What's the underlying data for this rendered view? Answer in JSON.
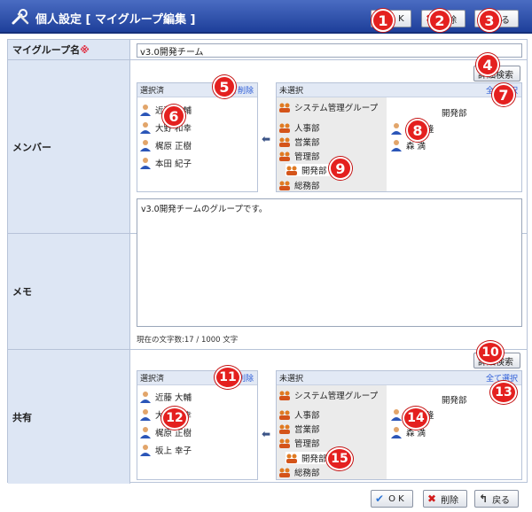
{
  "header": {
    "title": "個人設定 [ マイグループ編集 ]",
    "ok_label": "O K",
    "delete_label": "削除",
    "back_label": "戻る"
  },
  "form": {
    "group_name": {
      "label": "マイグループ名",
      "required_mark": "※",
      "value": "v3.0開発チーム"
    },
    "members": {
      "label": "メンバー",
      "detail_search_label": "詳細検索",
      "selected": {
        "header": "選択済",
        "delete_all": "全て削除",
        "people": [
          "近藤 大輔",
          "大野 和幸",
          "梶原 正樹",
          "本田 紀子"
        ]
      },
      "unselected": {
        "header": "未選択",
        "select_all": "全て選択",
        "groups": [
          "システム管理グループ",
          "人事部",
          "営業部",
          "管理部"
        ],
        "sub_group": "開発部",
        "last_group": "総務部",
        "right_heading": "開発部",
        "people": [
          "高橋 隆",
          "森 満"
        ]
      }
    },
    "memo": {
      "label": "メモ",
      "value": "v3.0開発チームのグループです。",
      "counter": "現在の文字数:17 / 1000 文字"
    },
    "share": {
      "label": "共有",
      "detail_search_label": "詳細検索",
      "selected": {
        "header": "選択済",
        "delete_all": "全て削除",
        "people": [
          "近藤 大輔",
          "大野 和幸",
          "梶原 正樹",
          "坂上 幸子"
        ]
      },
      "unselected": {
        "header": "未選択",
        "select_all": "全て選択",
        "groups": [
          "システム管理グループ",
          "人事部",
          "営業部",
          "管理部"
        ],
        "sub_group": "開発部",
        "last_group": "総務部",
        "right_heading": "開発部",
        "people": [
          "高橋 隆",
          "森 満"
        ]
      }
    }
  },
  "footer": {
    "ok_label": "O K",
    "delete_label": "削除",
    "back_label": "戻る"
  },
  "callouts": [
    "1",
    "2",
    "3",
    "4",
    "5",
    "6",
    "7",
    "8",
    "9",
    "10",
    "11",
    "12",
    "13",
    "14",
    "15"
  ],
  "colors": {
    "header_bg": "#2b4fae",
    "label_bg": "#dde6f4",
    "badge": "#e4201f",
    "link": "#2a5bd7"
  }
}
